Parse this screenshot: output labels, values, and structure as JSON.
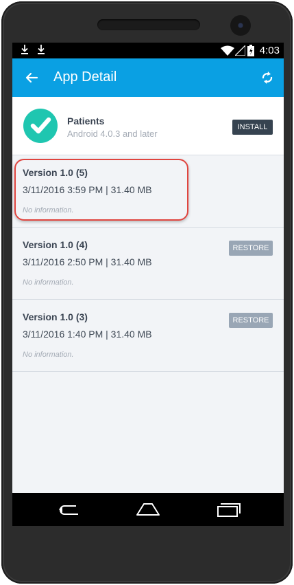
{
  "status_bar": {
    "time": "4:03",
    "icons": [
      "download-icon",
      "download-icon",
      "wifi-icon",
      "signal-icon",
      "battery-icon"
    ]
  },
  "app_bar": {
    "title": "App Detail",
    "back_icon": "back-arrow-icon",
    "refresh_icon": "refresh-icon",
    "color": "#0aa0e3"
  },
  "app": {
    "name": "Patients",
    "requirement": "Android 4.0.3 and later",
    "install_label": "INSTALL",
    "icon": "checkmark-icon",
    "icon_color": "#1fc6b0"
  },
  "versions": [
    {
      "title": "Version 1.0 (5)",
      "meta": "3/11/2016 3:59 PM | 31.40 MB",
      "info": "No information.",
      "action": ""
    },
    {
      "title": "Version 1.0 (4)",
      "meta": "3/11/2016 2:50 PM | 31.40 MB",
      "info": "No information.",
      "action": "RESTORE"
    },
    {
      "title": "Version 1.0 (3)",
      "meta": "3/11/2016 1:40 PM | 31.40 MB",
      "info": "No information.",
      "action": "RESTORE"
    }
  ],
  "nav_bar": {
    "icons": [
      "nav-back-icon",
      "nav-home-icon",
      "nav-recents-icon"
    ]
  }
}
